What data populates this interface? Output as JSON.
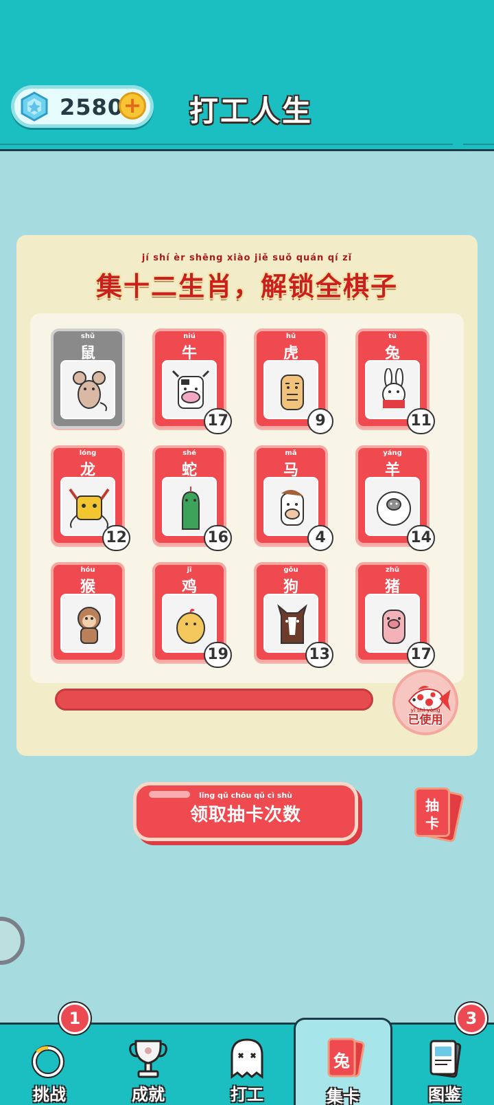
{
  "colors": {
    "header_bg": "#1bbfc2",
    "page_bg": "#a6dcdf",
    "card_red": "#ef4a50",
    "panel_bg": "#f2ecc9"
  },
  "header": {
    "gem_icon": "diamond-gem-icon",
    "gem_count": "2580",
    "add_icon": "plus-icon",
    "add_symbol": "+",
    "title": "打工人生"
  },
  "banner": {
    "pinyin": "jí  shí  èr  shēng xiào    jiě  suǒ quán  qí   zǐ",
    "title": "集十二生肖，解锁全棋子"
  },
  "zodiac_cards": [
    {
      "pinyin": "shǔ",
      "name": "鼠",
      "count": "",
      "locked": true,
      "icon": "rat-icon"
    },
    {
      "pinyin": "niú",
      "name": "牛",
      "count": "17",
      "locked": false,
      "icon": "ox-icon"
    },
    {
      "pinyin": "hǔ",
      "name": "虎",
      "count": "9",
      "locked": false,
      "icon": "tiger-icon"
    },
    {
      "pinyin": "tù",
      "name": "兔",
      "count": "11",
      "locked": false,
      "icon": "rabbit-icon"
    },
    {
      "pinyin": "lóng",
      "name": "龙",
      "count": "12",
      "locked": false,
      "icon": "dragon-icon"
    },
    {
      "pinyin": "shé",
      "name": "蛇",
      "count": "16",
      "locked": false,
      "icon": "snake-icon"
    },
    {
      "pinyin": "mǎ",
      "name": "马",
      "count": "4",
      "locked": false,
      "icon": "horse-icon"
    },
    {
      "pinyin": "yáng",
      "name": "羊",
      "count": "14",
      "locked": false,
      "icon": "sheep-icon"
    },
    {
      "pinyin": "hóu",
      "name": "猴",
      "count": "",
      "locked": false,
      "icon": "monkey-icon"
    },
    {
      "pinyin": "jī",
      "name": "鸡",
      "count": "19",
      "locked": false,
      "icon": "chicken-icon"
    },
    {
      "pinyin": "gǒu",
      "name": "狗",
      "count": "13",
      "locked": false,
      "icon": "dog-icon"
    },
    {
      "pinyin": "zhū",
      "name": "猪",
      "count": "17",
      "locked": false,
      "icon": "pig-icon"
    }
  ],
  "progress": {
    "fraction": 1.0
  },
  "koi": {
    "icon": "koi-fish-icon",
    "pinyin": "yǐ  shǐ yòng",
    "label": "已使用"
  },
  "claim_button": {
    "pinyin": "lǐng  qǔ  chōu  qǔ  cì  shù",
    "label": "领取抽卡次数"
  },
  "draw_card": {
    "icon": "card-stack-icon",
    "label": "抽卡"
  },
  "nav": {
    "items": [
      {
        "label": "挑战",
        "icon": "ring-icon",
        "badge": "1"
      },
      {
        "label": "成就",
        "icon": "trophy-icon",
        "badge": ""
      },
      {
        "label": "打工",
        "icon": "ghost-icon",
        "badge": ""
      },
      {
        "label": "集卡",
        "icon": "rabbit-card-icon",
        "badge": "",
        "card_text": "兔"
      },
      {
        "label": "图鉴",
        "icon": "book-icon",
        "badge": "3"
      }
    ]
  }
}
